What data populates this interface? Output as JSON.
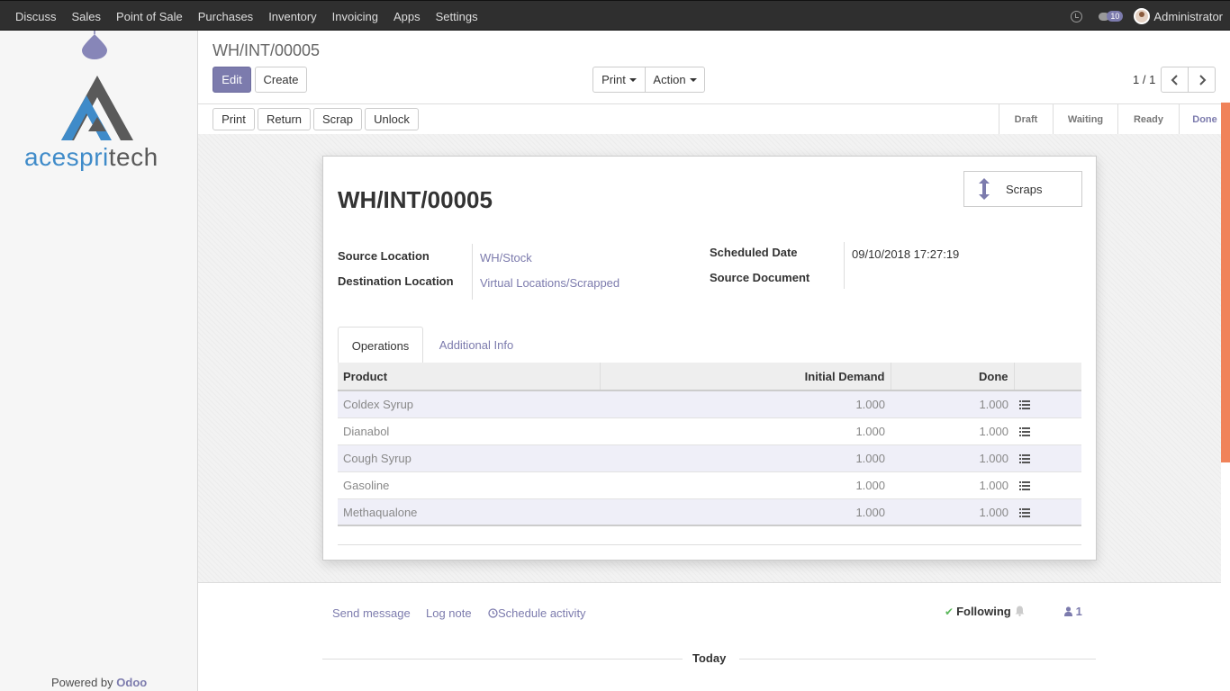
{
  "topbar": {
    "menu": [
      "Discuss",
      "Sales",
      "Point of Sale",
      "Purchases",
      "Inventory",
      "Invoicing",
      "Apps",
      "Settings"
    ],
    "message_count": "10",
    "user": "Administrator"
  },
  "sidebar": {
    "logo_part1": "acespri",
    "logo_part2": "tech",
    "powered_prefix": "Powered by",
    "powered_brand": "Odoo"
  },
  "control_panel": {
    "breadcrumb": "WH/INT/00005",
    "edit_label": "Edit",
    "create_label": "Create",
    "print_label": "Print",
    "action_label": "Action",
    "pager": "1 / 1"
  },
  "statusbar": {
    "buttons": [
      "Print",
      "Return",
      "Scrap",
      "Unlock"
    ],
    "stages": [
      "Draft",
      "Waiting",
      "Ready",
      "Done"
    ],
    "active_stage": "Done"
  },
  "form": {
    "title": "WH/INT/00005",
    "scraps_label": "Scraps",
    "source_location_label": "Source Location",
    "source_location": "WH/Stock",
    "destination_location_label": "Destination Location",
    "destination_location": "Virtual Locations/Scrapped",
    "scheduled_date_label": "Scheduled Date",
    "scheduled_date": "09/10/2018 17:27:19",
    "source_document_label": "Source Document",
    "tabs": [
      "Operations",
      "Additional Info"
    ],
    "columns": [
      "Product",
      "Initial Demand",
      "Done"
    ],
    "rows": [
      {
        "product": "Coldex Syrup",
        "demand": "1.000",
        "done": "1.000"
      },
      {
        "product": "Dianabol",
        "demand": "1.000",
        "done": "1.000"
      },
      {
        "product": "Cough Syrup",
        "demand": "1.000",
        "done": "1.000"
      },
      {
        "product": "Gasoline",
        "demand": "1.000",
        "done": "1.000"
      },
      {
        "product": "Methaqualone",
        "demand": "1.000",
        "done": "1.000"
      }
    ]
  },
  "chatter": {
    "send_message": "Send message",
    "log_note": "Log note",
    "schedule_activity": "Schedule activity",
    "following": "Following",
    "followers": "1",
    "today": "Today"
  },
  "colors": {
    "brand": "#7c7bad",
    "topbar": "#2f2f2f",
    "scrollbar": "#f0835a"
  }
}
